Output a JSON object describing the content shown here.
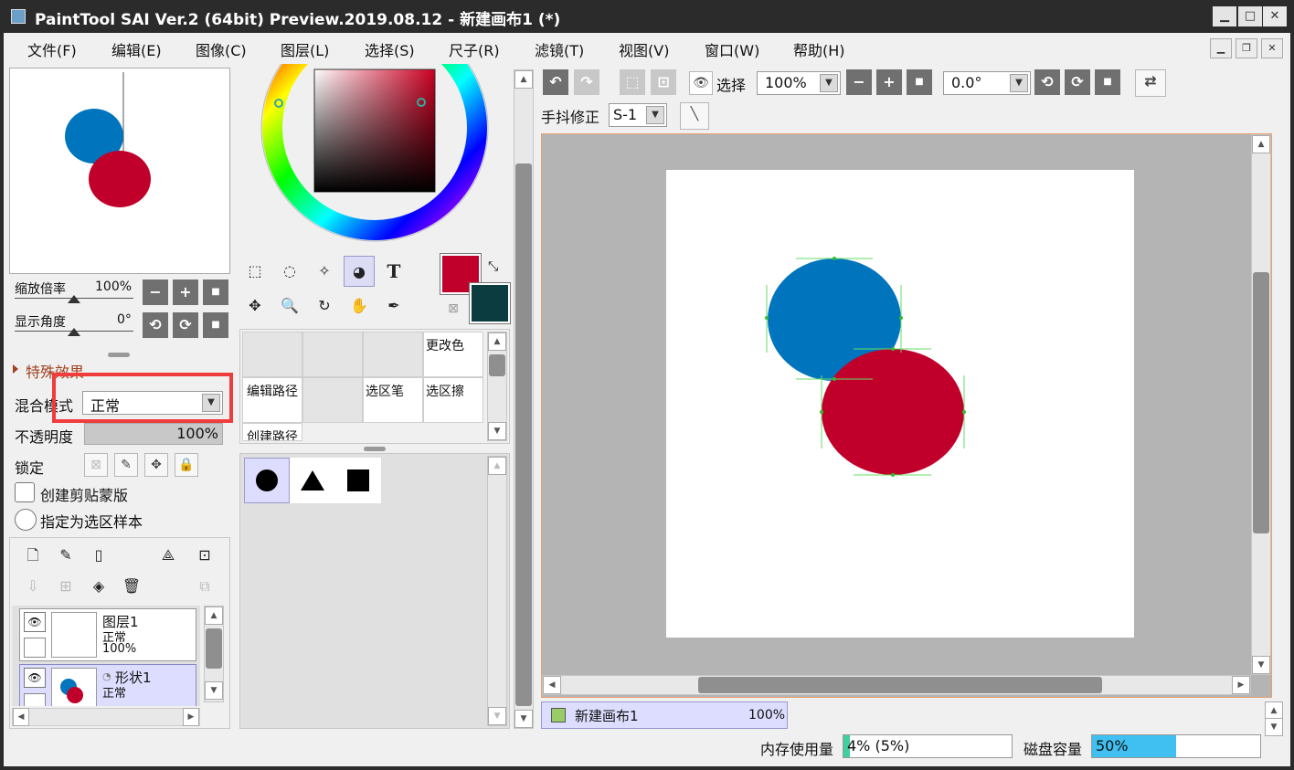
{
  "window": {
    "title": "PaintTool SAI Ver.2 (64bit) Preview.2019.08.12 - 新建画布1 (*)"
  },
  "menu": [
    "文件(F)",
    "编辑(E)",
    "图像(C)",
    "图层(L)",
    "选择(S)",
    "尺子(R)",
    "滤镜(T)",
    "视图(V)",
    "窗口(W)",
    "帮助(H)"
  ],
  "navigator": {
    "zoom_label": "缩放倍率",
    "zoom_value": "100%",
    "angle_label": "显示角度",
    "angle_value": "0°"
  },
  "layer_props": {
    "section": "特殊效果",
    "blend_label": "混合模式",
    "blend_value": "正常",
    "opacity_label": "不透明度",
    "opacity_value": "100%",
    "opacity": 1.0,
    "lock_label": "锁定",
    "clip_label": "创建剪贴蒙版",
    "sample_label": "指定为选区样本"
  },
  "layers": [
    {
      "name": "图层1",
      "mode": "正常",
      "opacity": "100%"
    },
    {
      "name": "形状1",
      "mode": "正常"
    }
  ],
  "colors": {
    "primary": "#c0002a",
    "secondary": "#0a3c40",
    "blue_shape": "#0075bd",
    "red_shape": "#c0002a",
    "highlight": "#f03c3c"
  },
  "tool_grid": {
    "cells": [
      "更改色",
      "编辑路径",
      "选区笔",
      "选区擦",
      "创建路径"
    ]
  },
  "canvas_toolbar": {
    "select_label": "选择",
    "zoom_value": "100%",
    "angle_value": "0.0°",
    "stab_label": "手抖修正",
    "stab_value": "S-1"
  },
  "canvas_tab": {
    "name": "新建画布1",
    "zoom": "100%"
  },
  "status": {
    "mem_label": "内存使用量",
    "mem_value": "4% (5%)",
    "mem_fraction": 0.04,
    "disk_label": "磁盘容量",
    "disk_value": "50%",
    "disk_fraction": 0.5
  },
  "icons": {
    "text_tool": "T"
  }
}
